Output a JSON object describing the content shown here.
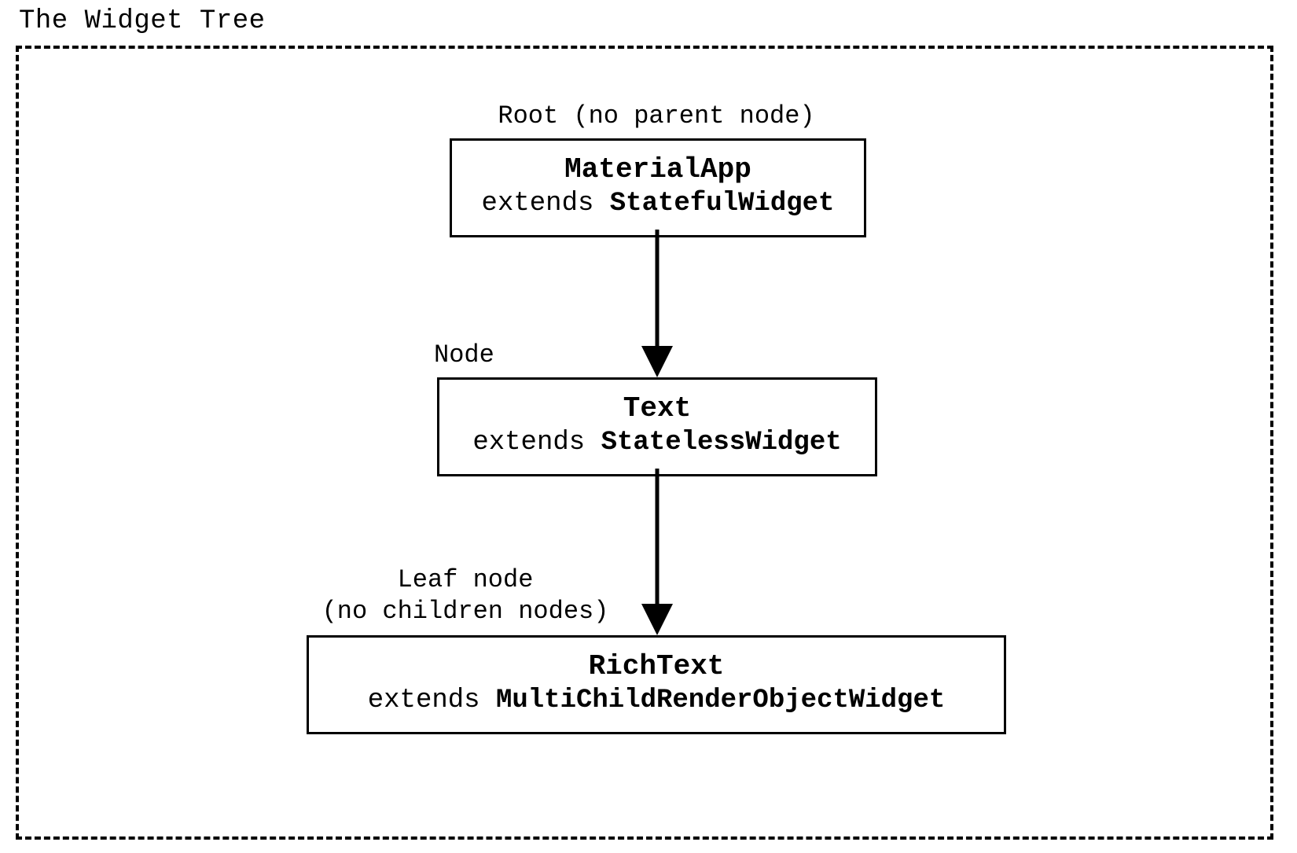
{
  "title": "The Widget Tree",
  "nodes": [
    {
      "annotation": "Root (no parent node)",
      "name": "MaterialApp",
      "extends_prefix": "extends ",
      "extends_class": "StatefulWidget"
    },
    {
      "annotation": "Node",
      "name": "Text",
      "extends_prefix": "extends ",
      "extends_class": "StatelessWidget"
    },
    {
      "annotation_line1": "Leaf node",
      "annotation_line2": "(no children nodes)",
      "name": "RichText",
      "extends_prefix": "extends ",
      "extends_class": "MultiChildRenderObjectWidget"
    }
  ]
}
